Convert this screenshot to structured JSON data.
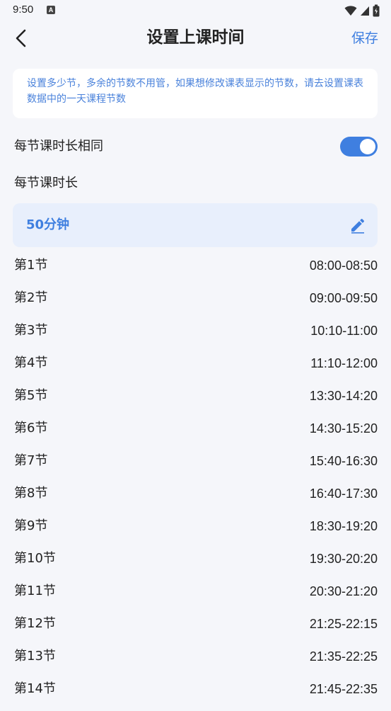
{
  "status_bar": {
    "time": "9:50",
    "a_badge": "A"
  },
  "header": {
    "title": "设置上课时间",
    "save_label": "保存"
  },
  "hint": {
    "text": "设置多少节，多余的节数不用管，如果想修改课表显示的节数，请去设置课表数据中的一天课程节数"
  },
  "same_length": {
    "label": "每节课时长相同",
    "enabled": true
  },
  "duration": {
    "section_label": "每节课时长",
    "value": "50分钟"
  },
  "periods": [
    {
      "name": "第1节",
      "time": "08:00-08:50"
    },
    {
      "name": "第2节",
      "time": "09:00-09:50"
    },
    {
      "name": "第3节",
      "time": "10:10-11:00"
    },
    {
      "name": "第4节",
      "time": "11:10-12:00"
    },
    {
      "name": "第5节",
      "time": "13:30-14:20"
    },
    {
      "name": "第6节",
      "time": "14:30-15:20"
    },
    {
      "name": "第7节",
      "time": "15:40-16:30"
    },
    {
      "name": "第8节",
      "time": "16:40-17:30"
    },
    {
      "name": "第9节",
      "time": "18:30-19:20"
    },
    {
      "name": "第10节",
      "time": "19:30-20:20"
    },
    {
      "name": "第11节",
      "time": "20:30-21:20"
    },
    {
      "name": "第12节",
      "time": "21:25-22:15"
    },
    {
      "name": "第13节",
      "time": "21:35-22:25"
    },
    {
      "name": "第14节",
      "time": "21:45-22:35"
    }
  ],
  "colors": {
    "accent": "#3f7fe0",
    "hint_text": "#4a82db",
    "duration_bg": "#e8effc",
    "page_bg": "#f5f6fa"
  },
  "icons": {
    "back": "arrow-back-icon",
    "edit": "pencil-icon",
    "wifi": "wifi-icon",
    "signal": "signal-icon",
    "battery": "battery-icon"
  }
}
